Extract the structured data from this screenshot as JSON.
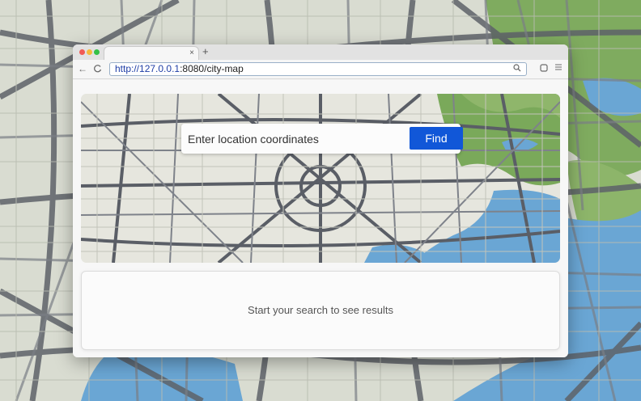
{
  "browser": {
    "tab": {
      "close_glyph": "×"
    },
    "new_tab_glyph": "+",
    "nav": {
      "back_glyph": "←",
      "reload_glyph": "C"
    },
    "url": {
      "scheme": "http://",
      "host": "127.0.0.1",
      "rest": ":8080/city-map"
    },
    "toolbar_icons": [
      "search-icon",
      "extension-icon",
      "menu-icon"
    ]
  },
  "search": {
    "placeholder": "Enter location coordinates",
    "button_label": "Find"
  },
  "results": {
    "message": "Start your search to see results"
  },
  "colors": {
    "accent": "#1157d8",
    "water": "#6aa6d4",
    "park": "#79a85a",
    "road": "#5e6269"
  }
}
